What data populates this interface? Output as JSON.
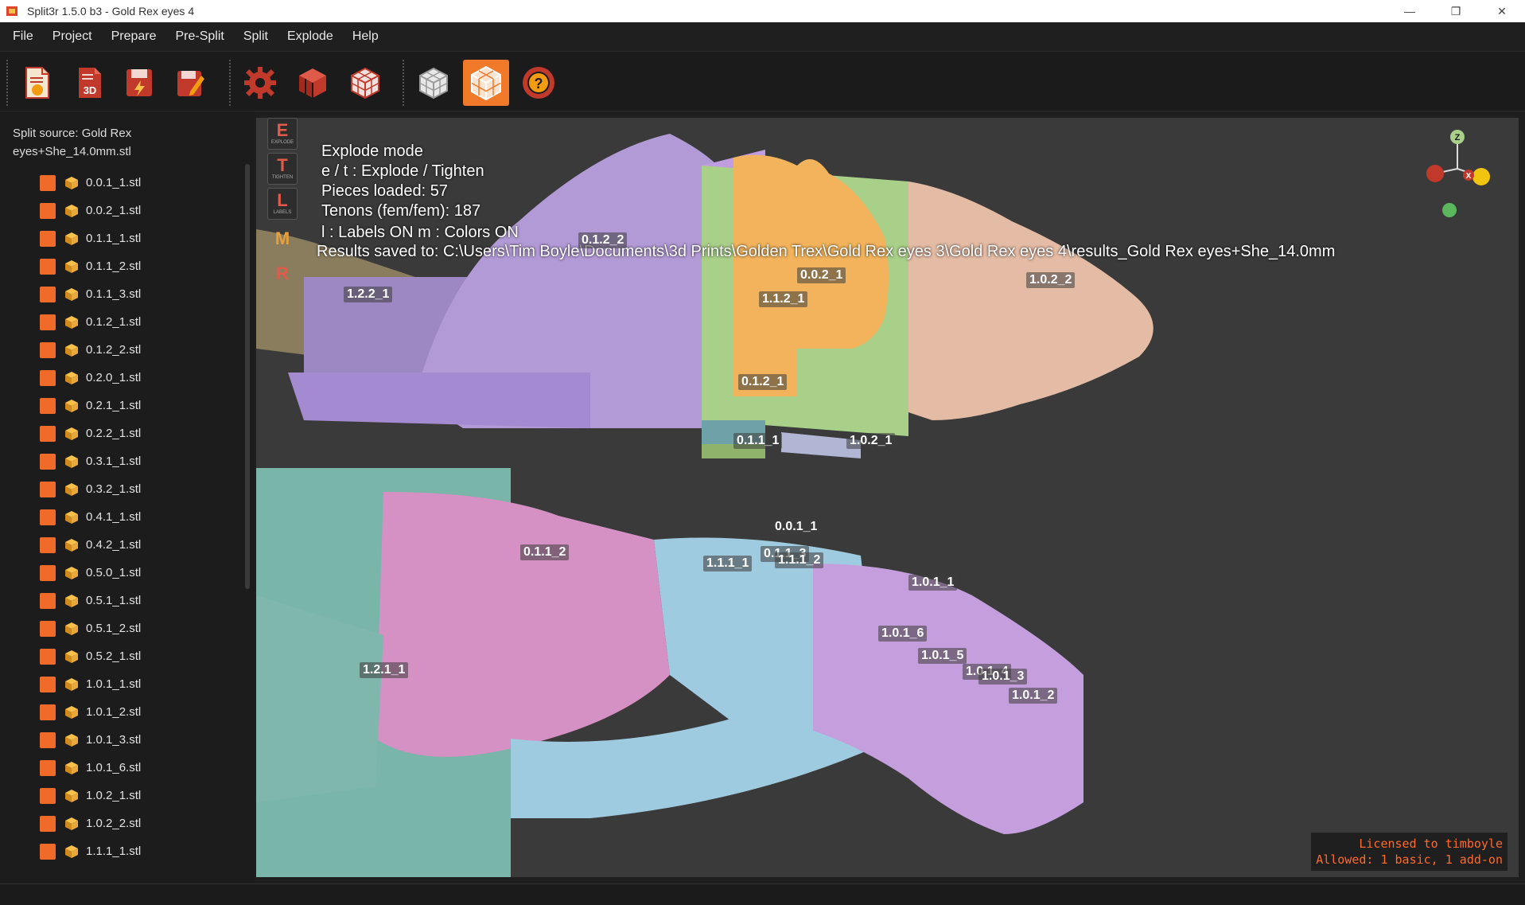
{
  "window": {
    "title": "Split3r 1.5.0 b3 - Gold Rex eyes 4",
    "minimize_glyph": "—",
    "maximize_glyph": "❐",
    "close_glyph": "✕"
  },
  "menu": [
    "File",
    "Project",
    "Prepare",
    "Pre-Split",
    "Split",
    "Explode",
    "Help"
  ],
  "toolbar": {
    "new_project_icon": "new-project-icon",
    "open_3d_label": "3D",
    "active_tool": "explode-view",
    "accent": "#f07a2a"
  },
  "sidebar": {
    "source": "Split source: Gold Rex eyes+She_14.0mm.stl",
    "files": [
      "0.0.1_1.stl",
      "0.0.2_1.stl",
      "0.1.1_1.stl",
      "0.1.1_2.stl",
      "0.1.1_3.stl",
      "0.1.2_1.stl",
      "0.1.2_2.stl",
      "0.2.0_1.stl",
      "0.2.1_1.stl",
      "0.2.2_1.stl",
      "0.3.1_1.stl",
      "0.3.2_1.stl",
      "0.4.1_1.stl",
      "0.4.2_1.stl",
      "0.5.0_1.stl",
      "0.5.1_1.stl",
      "0.5.1_2.stl",
      "0.5.2_1.stl",
      "1.0.1_1.stl",
      "1.0.1_2.stl",
      "1.0.1_3.stl",
      "1.0.1_6.stl",
      "1.0.2_1.stl",
      "1.0.2_2.stl",
      "1.1.1_1.stl"
    ]
  },
  "viewport": {
    "mode_buttons": [
      {
        "letter": "E",
        "caption": "EXPLODE"
      },
      {
        "letter": "T",
        "caption": "TIGHTEN"
      },
      {
        "letter": "L",
        "caption": "LABELS"
      },
      {
        "letter": "M",
        "caption": ""
      },
      {
        "letter": "R",
        "caption": ""
      }
    ],
    "info": {
      "mode": "Explode mode",
      "keys": "e / t : Explode / Tighten",
      "pieces": "Pieces loaded: 57",
      "tenons": "Tenons (fem/fem): 187",
      "toggles": "l : Labels ON    m : Colors ON",
      "results": "Results saved to: C:\\Users\\Tim Boyle\\Documents\\3d Prints\\Golden Trex\\Gold Rex eyes 3\\Gold Rex eyes 4\\results_Gold Rex eyes+She_14.0mm"
    },
    "axes": {
      "z": "Z",
      "x": "X"
    },
    "part_labels": [
      "0.1.2_2",
      "1.2.2_1",
      "0.0.2_1",
      "1.1.2_1",
      "1.0.2_2",
      "0.1.2_1",
      "0.1.1_1",
      "1.0.2_1",
      "0.0.1_1",
      "0.1.1_2",
      "1.1.1_1",
      "0.1.1_3",
      "1.1.1_2",
      "1.0.1_1",
      "1.0.1_6",
      "1.0.1_5",
      "1.2.1_1",
      "1.0.1_4",
      "1.0.1_3",
      "1.0.1_2"
    ],
    "colors": {
      "purple": "#b29ad6",
      "pink": "#d590c4",
      "blue": "#9fcbe0",
      "green": "#a9d089",
      "orange": "#f2b35c",
      "skin": "#e4bba4",
      "teal": "#7ab5aa",
      "olive": "#8a7d5e"
    }
  },
  "license": {
    "line1": "Licensed to timboyle",
    "line2": "Allowed: 1 basic, 1 add-on"
  }
}
